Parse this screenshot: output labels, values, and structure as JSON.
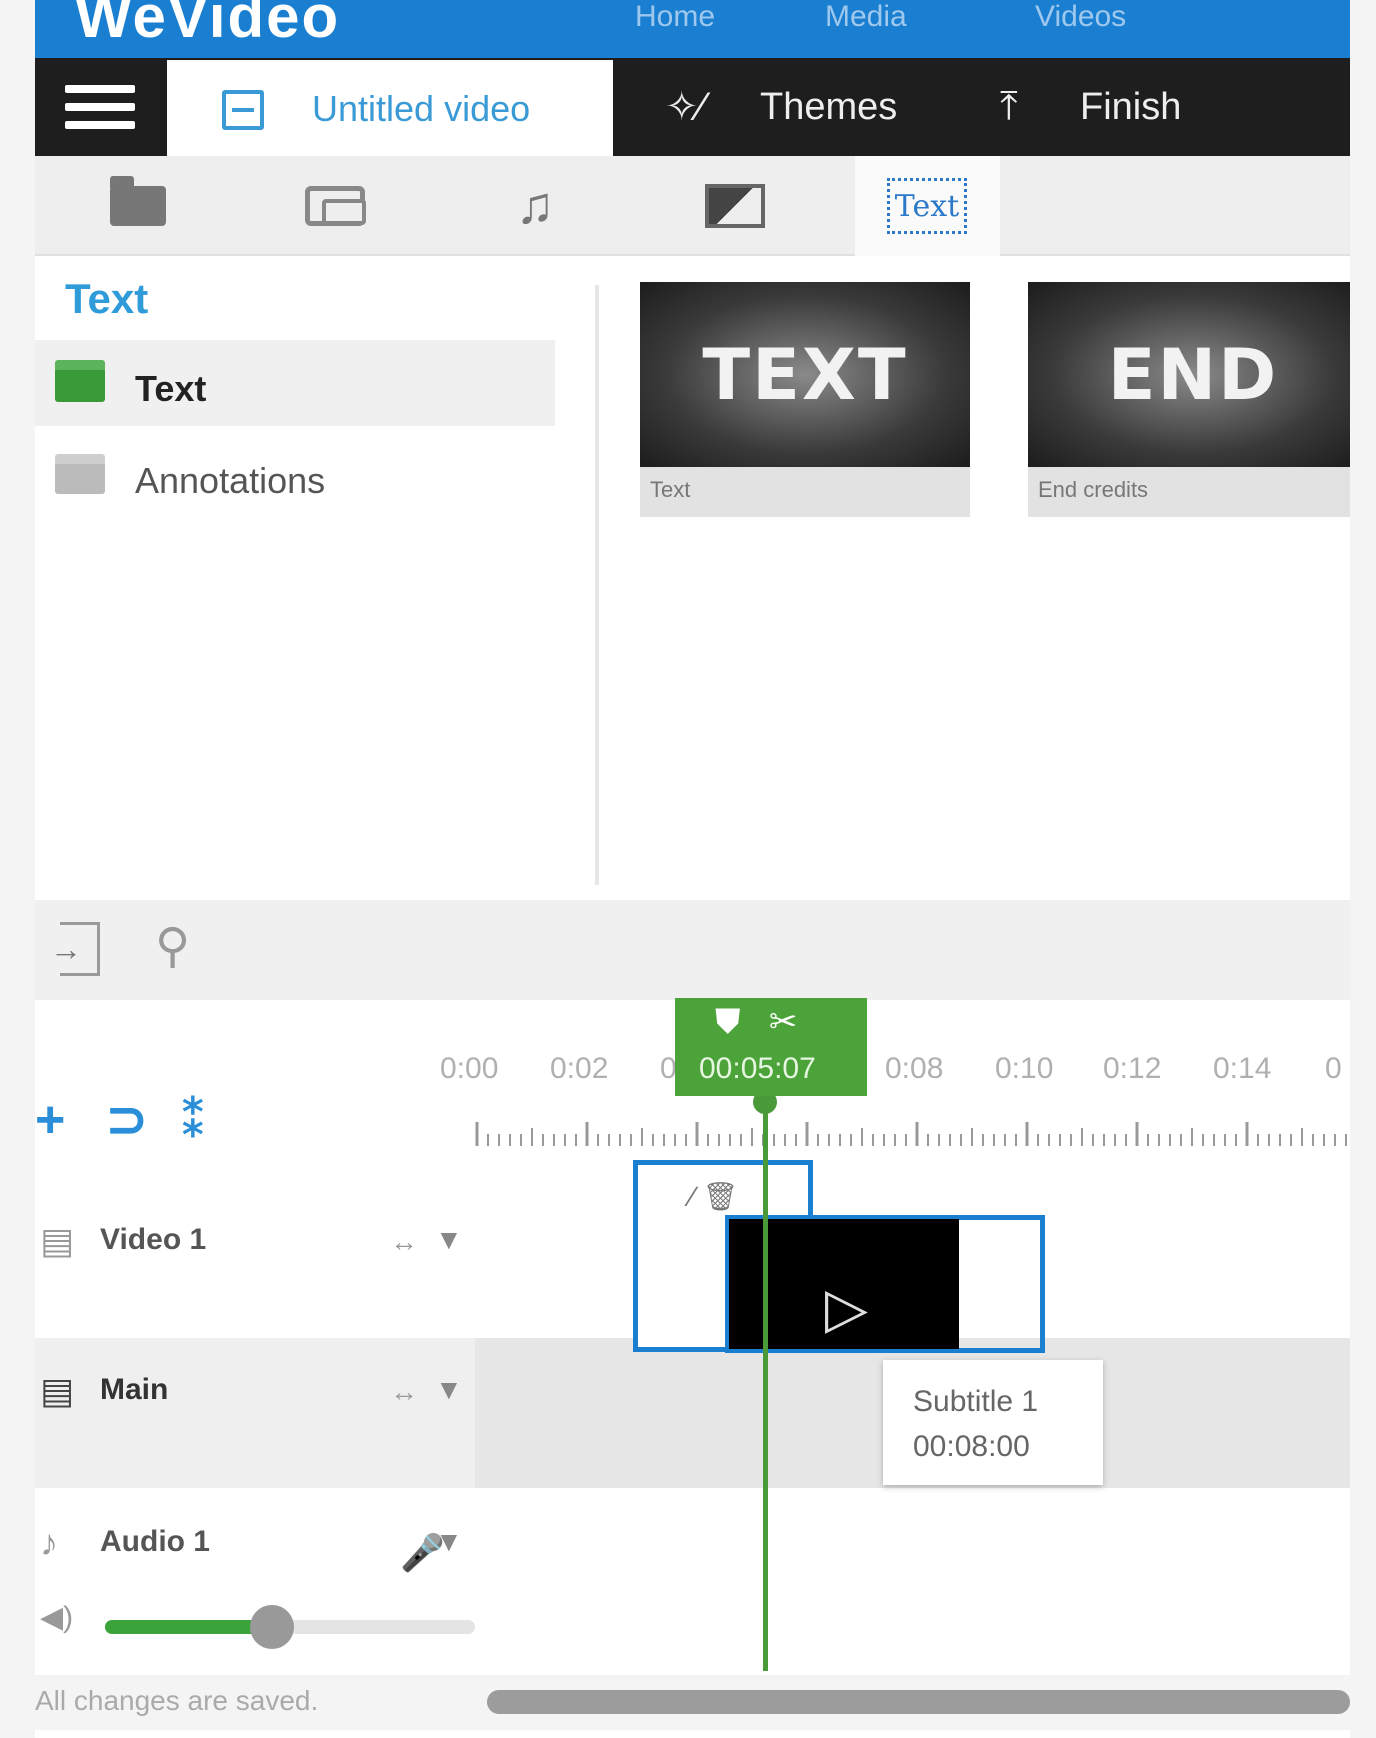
{
  "brand": {
    "name": "WeVideo",
    "nav": [
      "Home",
      "Media",
      "Videos"
    ]
  },
  "tabs": {
    "project_title": "Untitled video",
    "themes": "Themes",
    "finish": "Finish"
  },
  "media_toolbar": {
    "text_tool_label": "Text"
  },
  "library": {
    "title": "Text",
    "categories": [
      {
        "label": "Text"
      },
      {
        "label": "Annotations"
      }
    ],
    "items": [
      {
        "thumb_text": "TEXT",
        "caption": "Text"
      },
      {
        "thumb_text": "END",
        "caption": "End credits"
      }
    ]
  },
  "timeline": {
    "ruler": [
      "0:00",
      "0:02",
      "0",
      "0:08",
      "0:10",
      "0:12",
      "0:14",
      "0"
    ],
    "playhead_time": "00:05:07",
    "tracks": [
      {
        "label": "Video 1"
      },
      {
        "label": "Main"
      },
      {
        "label": "Audio 1"
      }
    ],
    "tooltip": {
      "title": "Subtitle 1",
      "time": "00:08:00"
    },
    "volume_level": 0.45
  },
  "status": "All changes are saved.",
  "colors": {
    "brand_blue": "#1a7fd0",
    "accent_green": "#4ba33a",
    "dark_bar": "#1e1e1e",
    "link_blue": "#2f9bd8"
  }
}
